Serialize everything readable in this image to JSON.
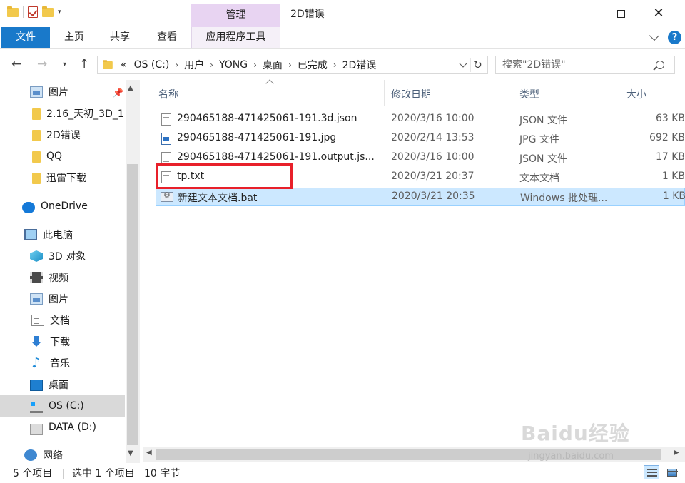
{
  "titlebar": {
    "manage_tab": "管理",
    "title": "2D错误",
    "close_glyph": "✕"
  },
  "ribbon": {
    "tabs": [
      "文件",
      "主页",
      "共享",
      "查看",
      "应用程序工具"
    ],
    "help": "?"
  },
  "address": {
    "crumbs": [
      "OS (C:)",
      "用户",
      "YONG",
      "桌面",
      "已完成",
      "2D错误"
    ],
    "overflow": "«",
    "separator": "›",
    "refresh_glyph": "↻"
  },
  "search": {
    "placeholder": "搜索\"2D错误\""
  },
  "sidebar": {
    "items": [
      {
        "label": "图片",
        "icon": "pictures-icon"
      },
      {
        "label": "2.16_天初_3D_1",
        "icon": "folder-icon"
      },
      {
        "label": "2D错误",
        "icon": "folder-icon"
      },
      {
        "label": "QQ",
        "icon": "folder-icon"
      },
      {
        "label": "迅雷下载",
        "icon": "folder-icon"
      },
      {
        "label": "OneDrive",
        "icon": "onedrive-icon"
      },
      {
        "label": "此电脑",
        "icon": "this-pc-icon"
      },
      {
        "label": "3D 对象",
        "icon": "3d-objects-icon"
      },
      {
        "label": "视频",
        "icon": "videos-icon"
      },
      {
        "label": "图片",
        "icon": "pictures-icon"
      },
      {
        "label": "文档",
        "icon": "documents-icon"
      },
      {
        "label": "下载",
        "icon": "downloads-icon"
      },
      {
        "label": "音乐",
        "icon": "music-icon"
      },
      {
        "label": "桌面",
        "icon": "desktop-icon"
      },
      {
        "label": "OS (C:)",
        "icon": "os-drive-icon"
      },
      {
        "label": "DATA (D:)",
        "icon": "drive-icon"
      },
      {
        "label": "网络",
        "icon": "network-icon"
      }
    ],
    "selected": "OS (C:)"
  },
  "columns": [
    "名称",
    "修改日期",
    "类型",
    "大小"
  ],
  "files": [
    {
      "name": "290465188-471425061-191.3d.json",
      "date": "2020/3/16 10:00",
      "type": "JSON 文件",
      "size": "63 KB",
      "icon": "json-file-icon"
    },
    {
      "name": "290465188-471425061-191.jpg",
      "date": "2020/2/14 13:53",
      "type": "JPG 文件",
      "size": "692 KB",
      "icon": "jpg-file-icon"
    },
    {
      "name": "290465188-471425061-191.output.js...",
      "date": "2020/3/16 10:00",
      "type": "JSON 文件",
      "size": "17 KB",
      "icon": "json-file-icon"
    },
    {
      "name": "tp.txt",
      "date": "2020/3/21 20:37",
      "type": "文本文档",
      "size": "1 KB",
      "icon": "text-file-icon"
    },
    {
      "name": "新建文本文档.bat",
      "date": "2020/3/21 20:35",
      "type": "Windows 批处理...",
      "size": "1 KB",
      "icon": "batch-file-icon"
    }
  ],
  "status": {
    "count": "5 个项目",
    "selection": "选中 1 个项目",
    "size": "10 字节"
  },
  "watermark": {
    "brand": "Baidu经验",
    "url": "jingyan.baidu.com"
  }
}
